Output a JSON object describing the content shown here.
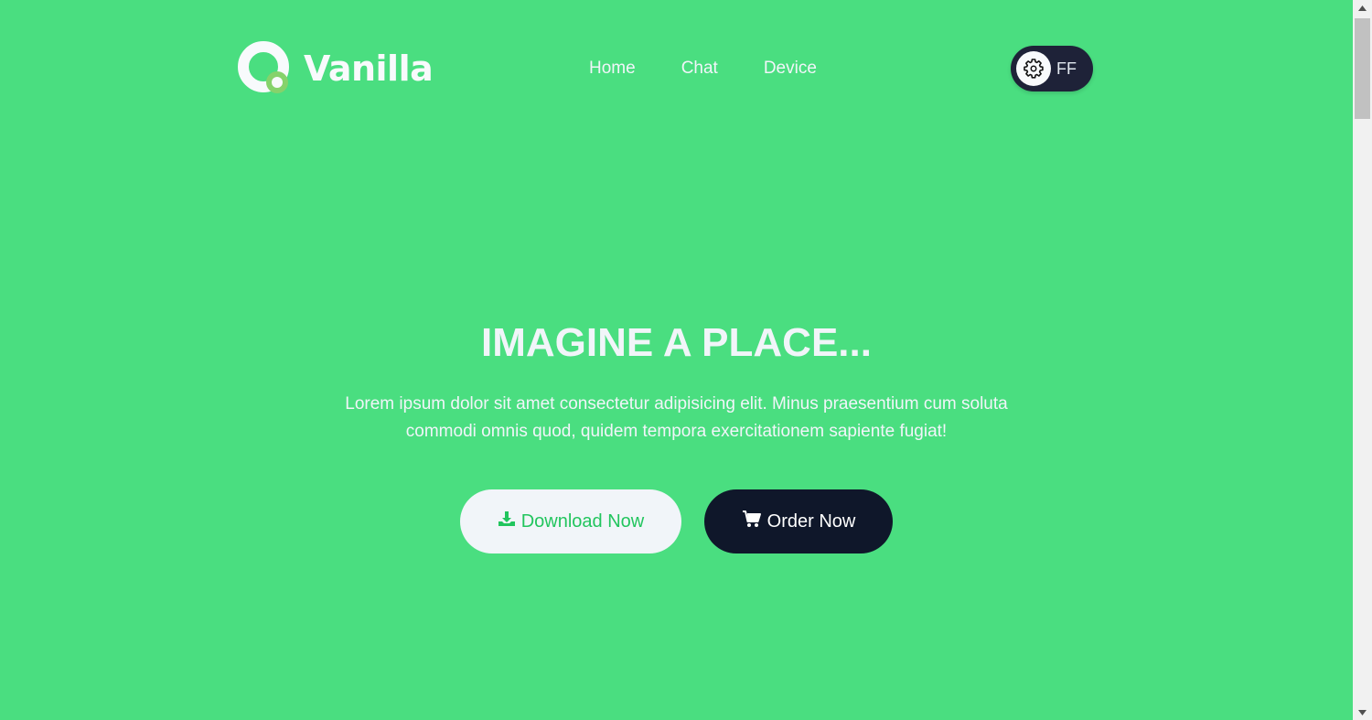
{
  "brand": {
    "name": "Vanilla",
    "logo_icon": "vanilla-logo-icon"
  },
  "nav": {
    "items": [
      {
        "label": "Home"
      },
      {
        "label": "Chat"
      },
      {
        "label": "Device"
      }
    ]
  },
  "user": {
    "initials": "FF",
    "settings_icon": "gear-icon"
  },
  "hero": {
    "title": "IMAGINE A PLACE...",
    "description": "Lorem ipsum dolor sit amet consectetur adipisicing elit. Minus praesentium cum soluta commodi omnis quod, quidem tempora exercitationem sapiente fugiat!",
    "download_label": "Download Now",
    "download_icon": "download-icon",
    "order_label": "Order Now",
    "order_icon": "cart-icon"
  },
  "colors": {
    "background": "#4ade80",
    "dark": "#0f172a",
    "light": "#f1f5f9",
    "accent": "#22c55e"
  }
}
